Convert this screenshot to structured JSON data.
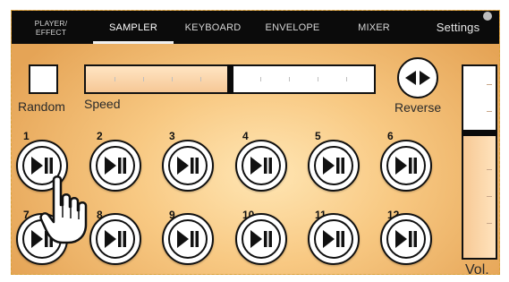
{
  "tabs": [
    {
      "id": "player-effect",
      "label": "PLAYER/\nEFFECT",
      "active": false
    },
    {
      "id": "sampler",
      "label": "SAMPLER",
      "active": true
    },
    {
      "id": "keyboard",
      "label": "KEYBOARD",
      "active": false
    },
    {
      "id": "envelope",
      "label": "ENVELOPE",
      "active": false
    },
    {
      "id": "mixer",
      "label": "MIXER",
      "active": false
    }
  ],
  "settings_label": "Settings",
  "controls": {
    "random_label": "Random",
    "speed_label": "Speed",
    "speed_value": 0.5,
    "reverse_label": "Reverse",
    "volume_label": "Vol.",
    "volume_value": 0.65
  },
  "pads": [
    {
      "number": "1"
    },
    {
      "number": "2"
    },
    {
      "number": "3"
    },
    {
      "number": "4"
    },
    {
      "number": "5"
    },
    {
      "number": "6"
    },
    {
      "number": "7"
    },
    {
      "number": "8"
    },
    {
      "number": "9"
    },
    {
      "number": "10"
    },
    {
      "number": "11"
    },
    {
      "number": "12"
    }
  ],
  "colors": {
    "tab_bar": "#0b0b0b",
    "panel_center": "#ffe6b4",
    "panel_edge": "#e5a456",
    "slider_fill": "#f6c896"
  },
  "icons": {
    "pad": "play-pause-icon",
    "reverse": "reverse-arrows-icon",
    "cursor": "hand-pointer-icon"
  }
}
